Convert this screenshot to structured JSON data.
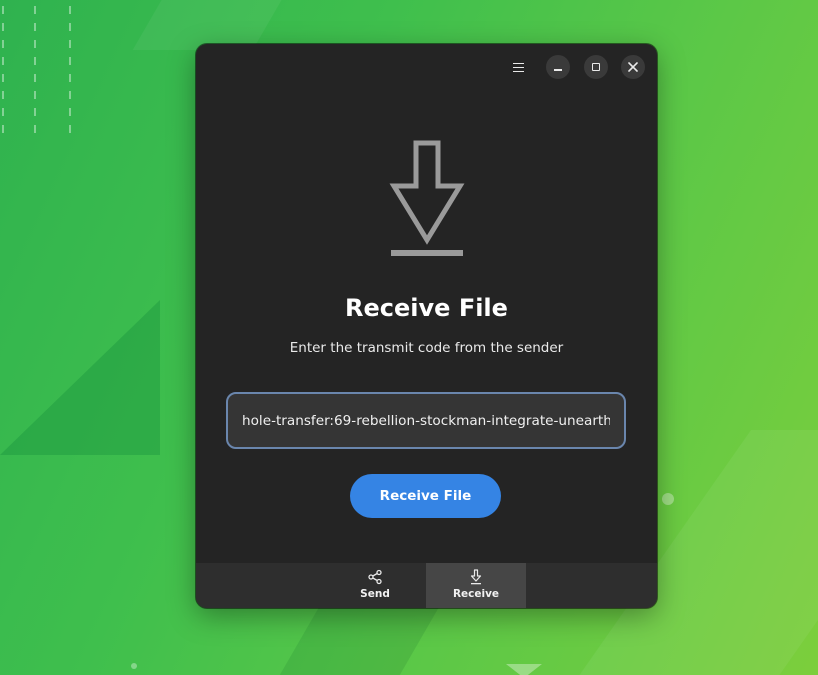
{
  "window": {
    "title": "Receive File",
    "subtitle": "Enter the transmit code from the sender",
    "hero_icon": "download-arrow-icon"
  },
  "titlebar": {
    "icons": [
      "menu-icon",
      "minimize-icon",
      "maximize-icon",
      "close-icon"
    ]
  },
  "code_input": {
    "value": "hole-transfer:69-rebellion-stockman-integrate-unearth"
  },
  "primary_button": {
    "label": "Receive File"
  },
  "bottom_tabs": [
    {
      "label": "Send",
      "icon": "share-icon",
      "active": false
    },
    {
      "label": "Receive",
      "icon": "download-icon",
      "active": true
    }
  ],
  "colors": {
    "accent": "#3584e4",
    "window_bg": "#242424",
    "input_border": "#6a86ad",
    "desktop_green": "#3fbf4d"
  }
}
